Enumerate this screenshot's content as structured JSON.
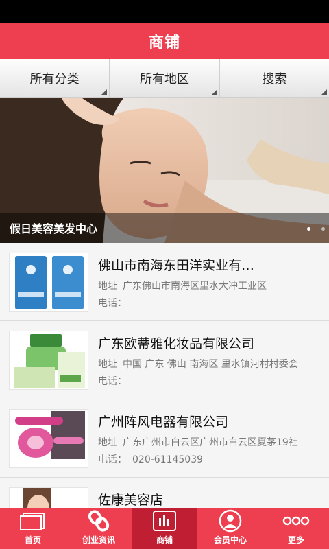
{
  "header": {
    "title": "商铺"
  },
  "filters": [
    {
      "label": "所有分类"
    },
    {
      "label": "所有地区"
    },
    {
      "label": "搜索"
    }
  ],
  "banner": {
    "caption": "假日美容美发中心",
    "slide_count": 2,
    "active_slide": 1
  },
  "shops": [
    {
      "name": "佛山市南海东田洋实业有…",
      "addr_label": "地址",
      "address": "广东佛山市南海区里水大冲工业区",
      "tel_label": "电话：",
      "phone": "",
      "thumb_icon": "blue-bottles-image"
    },
    {
      "name": "广东欧蒂雅化妆品有限公司",
      "addr_label": "地址",
      "address": "中国 广东 佛山 南海区 里水镇河村村委会",
      "tel_label": "电话：",
      "phone": "",
      "thumb_icon": "green-cream-jar-image"
    },
    {
      "name": "广州阵风电器有限公司",
      "addr_label": "地址",
      "address": "广东广州市白云区广州市白云区夏茅19社",
      "tel_label": "电话：",
      "phone": "020-61145039",
      "thumb_icon": "hair-curler-image"
    },
    {
      "name": "佐康美容店",
      "addr_label": "",
      "address": "",
      "tel_label": "",
      "phone": "",
      "thumb_icon": "woman-face-image"
    }
  ],
  "tabs": [
    {
      "label": "首页",
      "icon": "home-icon",
      "active": false
    },
    {
      "label": "创业资讯",
      "icon": "link-icon",
      "active": false
    },
    {
      "label": "商铺",
      "icon": "bar-chart-icon",
      "active": true
    },
    {
      "label": "会员中心",
      "icon": "user-icon",
      "active": false
    },
    {
      "label": "更多",
      "icon": "more-dots-icon",
      "active": false
    }
  ],
  "colors": {
    "brand_red": "#ee3f50",
    "active_tab": "#c01e32"
  }
}
